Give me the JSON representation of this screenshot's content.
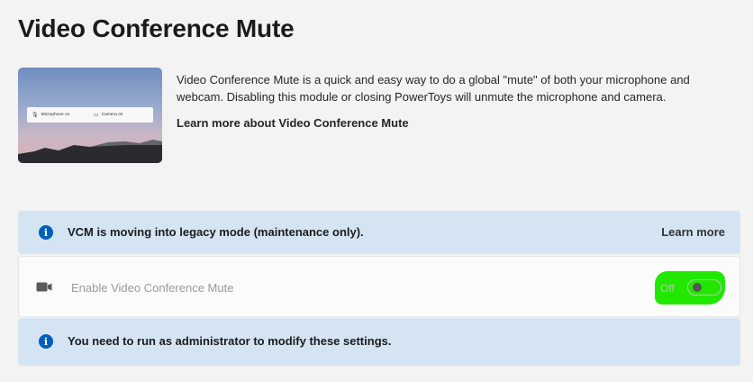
{
  "page": {
    "title": "Video Conference Mute"
  },
  "hero": {
    "microphone_label": "Microphone on",
    "camera_label": "Camera on"
  },
  "description": {
    "text": "Video Conference Mute is a quick and easy way to do a global \"mute\" of both your microphone and webcam. Disabling this module or closing PowerToys will unmute the microphone and camera.",
    "learn_more": "Learn more about Video Conference Mute"
  },
  "legacy_banner": {
    "icon": "info-icon",
    "text": "VCM is moving into legacy mode (maintenance only).",
    "action": "Learn more"
  },
  "enable_setting": {
    "icon": "camera-icon",
    "label": "Enable Video Conference Mute",
    "toggle_state": "Off",
    "enabled": false,
    "highlight_color": "#22e800"
  },
  "admin_banner": {
    "icon": "info-icon",
    "text": "You need to run as administrator to modify these settings."
  },
  "colors": {
    "background": "#f3f3f3",
    "info_bar": "#d4e4f3",
    "accent": "#005fb8"
  }
}
